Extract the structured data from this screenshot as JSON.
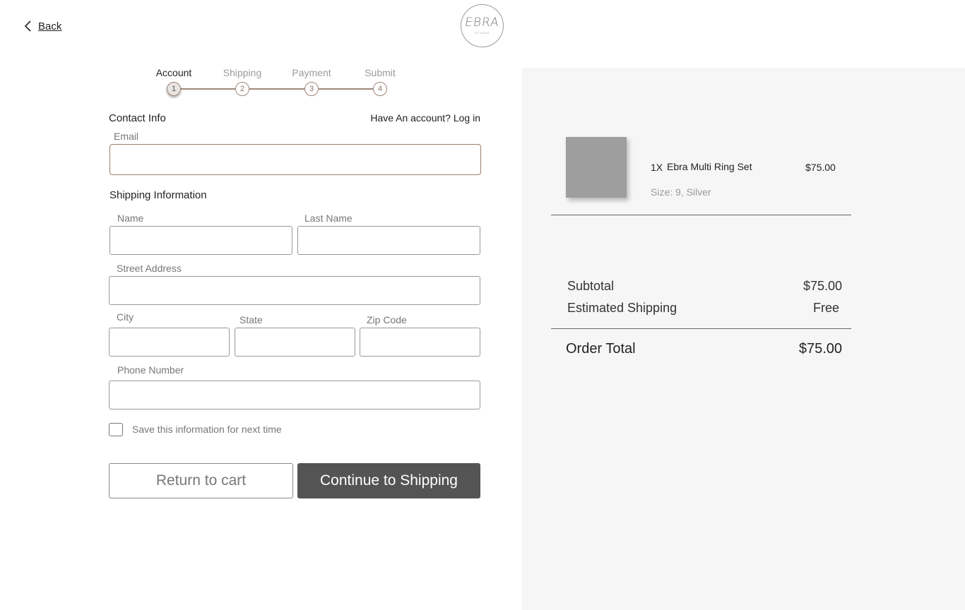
{
  "header": {
    "back_label": "Back",
    "logo_text": "EBRA",
    "logo_subtext": "STUDIO"
  },
  "steps": [
    {
      "label": "Account",
      "number": "1",
      "active": true
    },
    {
      "label": "Shipping",
      "number": "2",
      "active": false
    },
    {
      "label": "Payment",
      "number": "3",
      "active": false
    },
    {
      "label": "Submit",
      "number": "4",
      "active": false
    }
  ],
  "contact": {
    "title": "Contact Info",
    "login_prompt": "Have An account? Log in",
    "email_label": "Email",
    "email_value": ""
  },
  "shipping": {
    "title": "Shipping Information",
    "name_label": "Name",
    "last_name_label": "Last Name",
    "street_label": "Street Address",
    "city_label": "City",
    "state_label": "State",
    "zip_label": "Zip Code",
    "phone_label": "Phone Number"
  },
  "save_info_label": "Save this information for next time",
  "actions": {
    "return_label": "Return to cart",
    "continue_label": "Continue to Shipping"
  },
  "order": {
    "item": {
      "quantity": "1X",
      "name": "Ebra Multi Ring Set",
      "price": "$75.00",
      "variant": "Size: 9, Silver"
    },
    "subtotal_label": "Subtotal",
    "subtotal_value": "$75.00",
    "shipping_label": "Estimated Shipping",
    "shipping_value": "Free",
    "total_label": "Order Total",
    "total_value": "$75.00"
  },
  "colors": {
    "accent_brown": "#a0887a",
    "button_dark": "#545454",
    "panel_bg": "#f6f6f6"
  }
}
